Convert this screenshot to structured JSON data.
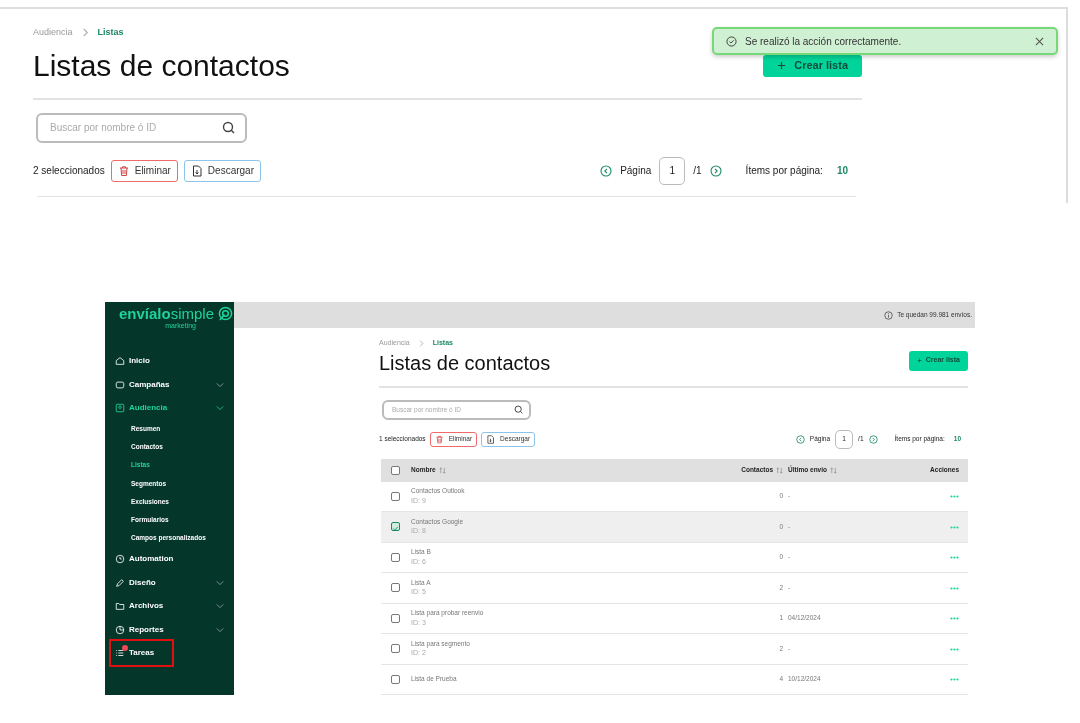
{
  "top_view": {
    "breadcrumb": [
      "Audiencia",
      "Listas"
    ],
    "title": "Listas de contactos",
    "create_button": "Crear lista",
    "toast": {
      "message": "Se realizó la acción correctamente."
    },
    "search": {
      "placeholder": "Buscar por nombre ó ID"
    },
    "selected_count": "2 seleccionados",
    "delete_button": "Eliminar",
    "download_button": "Descargar",
    "pagination": {
      "label": "Página",
      "page": "1",
      "total": "/1",
      "per_page_label": "Ítems por página:",
      "per_page": "10"
    }
  },
  "app_view": {
    "logo": {
      "brand": "**envíalo**simple",
      "tagline": "marketing"
    },
    "sidebar": {
      "items": [
        {
          "label": "Inicio",
          "selected": false
        },
        {
          "label": "Campañas",
          "selected": false,
          "expanded": false
        },
        {
          "label": "Audiencia",
          "selected": true,
          "expanded": true,
          "children": [
            {
              "label": "Resumen",
              "selected": false
            },
            {
              "label": "Contactos",
              "selected": false
            },
            {
              "label": "Listas",
              "selected": true
            },
            {
              "label": "Segmentos",
              "selected": false
            },
            {
              "label": "Exclusiones",
              "selected": false
            },
            {
              "label": "Formularios",
              "selected": false
            },
            {
              "label": "Campos personalizados",
              "selected": false
            }
          ]
        },
        {
          "label": "Automation",
          "selected": false
        },
        {
          "label": "Diseño",
          "selected": false,
          "expanded": false
        },
        {
          "label": "Archivos",
          "selected": false,
          "expanded": false
        },
        {
          "label": "Reportes",
          "selected": false,
          "expanded": false
        },
        {
          "label": "Tareas",
          "selected": false,
          "notification": true,
          "highlighted": true
        }
      ]
    },
    "topbar": {
      "sends_left": "Te quedan 99.981 envíos."
    },
    "breadcrumb": [
      "Audiencia",
      "Listas"
    ],
    "title": "Listas de contactos",
    "create_button": "Crear lista",
    "search": {
      "placeholder": "Buscar por nombre ó ID"
    },
    "selected_count": "1 seleccionados",
    "delete_button": "Eliminar",
    "download_button": "Descargar",
    "pagination": {
      "label": "Página",
      "page": "1",
      "total": "/1",
      "per_page_label": "Ítems por página:",
      "per_page": "10"
    },
    "table": {
      "header_checked": false,
      "columns": [
        "Nombre",
        "Contactos",
        "Último envío",
        "Acciones"
      ],
      "rows": [
        {
          "name": "Contactos Outlook",
          "id": "ID: 9",
          "contacts": "0",
          "last_send": "-",
          "checked": false
        },
        {
          "name": "Contactos Google",
          "id": "ID: 8",
          "contacts": "0",
          "last_send": "-",
          "checked": true
        },
        {
          "name": "Lista B",
          "id": "ID: 6",
          "contacts": "0",
          "last_send": "-",
          "checked": false
        },
        {
          "name": "Lista A",
          "id": "ID: 5",
          "contacts": "2",
          "last_send": "-",
          "checked": false
        },
        {
          "name": "Lista para probar reenvio",
          "id": "ID: 3",
          "contacts": "1",
          "last_send": "04/12/2024",
          "checked": false
        },
        {
          "name": "Lista para segmento",
          "id": "ID: 2",
          "contacts": "2",
          "last_send": "-",
          "checked": false
        },
        {
          "name": "Lista de Prueba",
          "contacts": "4",
          "last_send": "10/12/2024",
          "checked": false
        }
      ]
    }
  }
}
